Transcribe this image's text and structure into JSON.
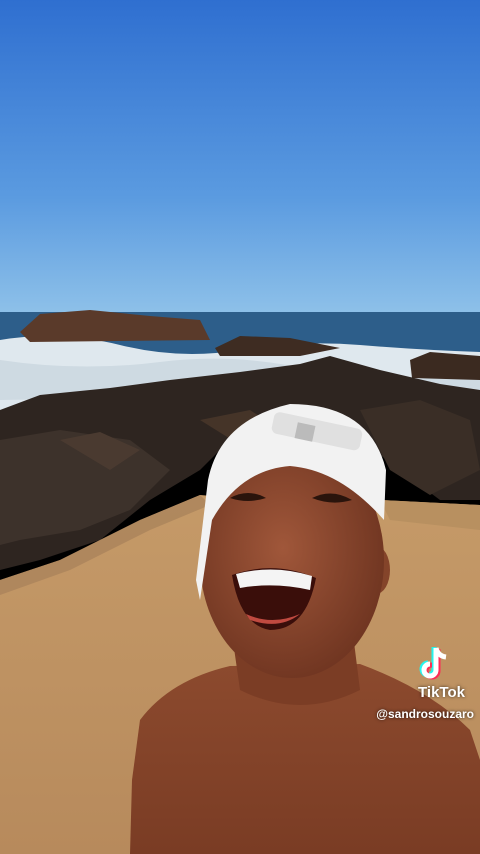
{
  "watermark": {
    "brand": "TikTok",
    "username": "@sandrosouzaro",
    "icon": "tiktok-logo-icon"
  },
  "colors": {
    "sky_top": "#2f6fd0",
    "sky_bottom": "#8cc0e8",
    "ocean": "#2d5e8a",
    "sand": "#c8a070",
    "skin": "#8a4a2c",
    "cap": "#f2f2f2"
  }
}
